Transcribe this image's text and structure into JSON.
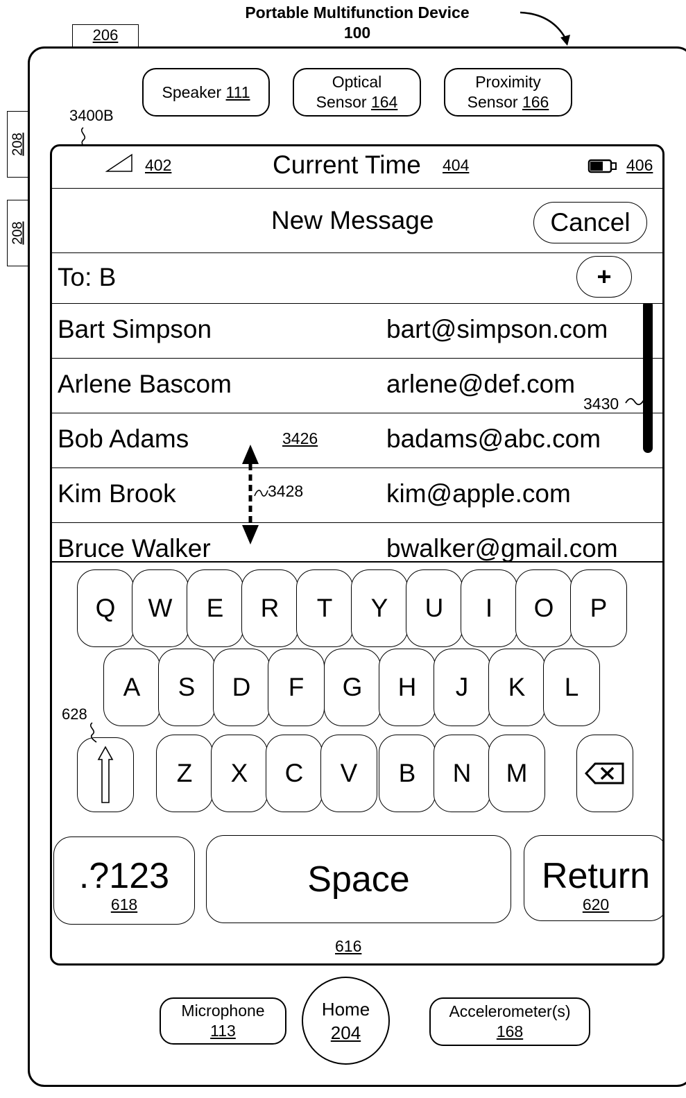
{
  "title": {
    "line1": "Portable Multifunction Device",
    "line2": "100"
  },
  "refs": {
    "r206": "206",
    "r208a": "208",
    "r208b": "208",
    "r3400": "3400B",
    "r402": "402",
    "r404": "404",
    "r406": "406",
    "r3426": "3426",
    "r3428": "3428",
    "r3430": "3430",
    "r628": "628",
    "r616": "616"
  },
  "hardware": {
    "speaker": {
      "label": "Speaker",
      "num": "111"
    },
    "optical": {
      "line1": "Optical",
      "label": "Sensor",
      "num": "164"
    },
    "proximity": {
      "line1": "Proximity",
      "label": "Sensor",
      "num": "166"
    },
    "microphone": {
      "label": "Microphone",
      "num": "113"
    },
    "home": {
      "label": "Home",
      "num": "204"
    },
    "accelerometer": {
      "label": "Accelerometer(s)",
      "num": "168"
    }
  },
  "status_bar": {
    "time": "Current Time"
  },
  "nav": {
    "title": "New Message",
    "cancel": "Cancel"
  },
  "to_field": {
    "value": "To: B",
    "add": "+"
  },
  "contacts": [
    {
      "name": "Bart Simpson",
      "email": "bart@simpson.com"
    },
    {
      "name": "Arlene Bascom",
      "email": "arlene@def.com"
    },
    {
      "name": "Bob Adams",
      "email": "badams@abc.com"
    },
    {
      "name": "Kim Brook",
      "email": "kim@apple.com"
    },
    {
      "name": "Bruce Walker",
      "email": "bwalker@gmail.com"
    }
  ],
  "keyboard": {
    "row1": [
      "Q",
      "W",
      "E",
      "R",
      "T",
      "Y",
      "U",
      "I",
      "O",
      "P"
    ],
    "row2": [
      "A",
      "S",
      "D",
      "F",
      "G",
      "H",
      "J",
      "K",
      "L"
    ],
    "row3": [
      "Z",
      "X",
      "C",
      "V",
      "B",
      "N",
      "M"
    ],
    "numbers": {
      "label": ".?123",
      "num": "618"
    },
    "space": "Space",
    "return": {
      "label": "Return",
      "num": "620"
    }
  }
}
